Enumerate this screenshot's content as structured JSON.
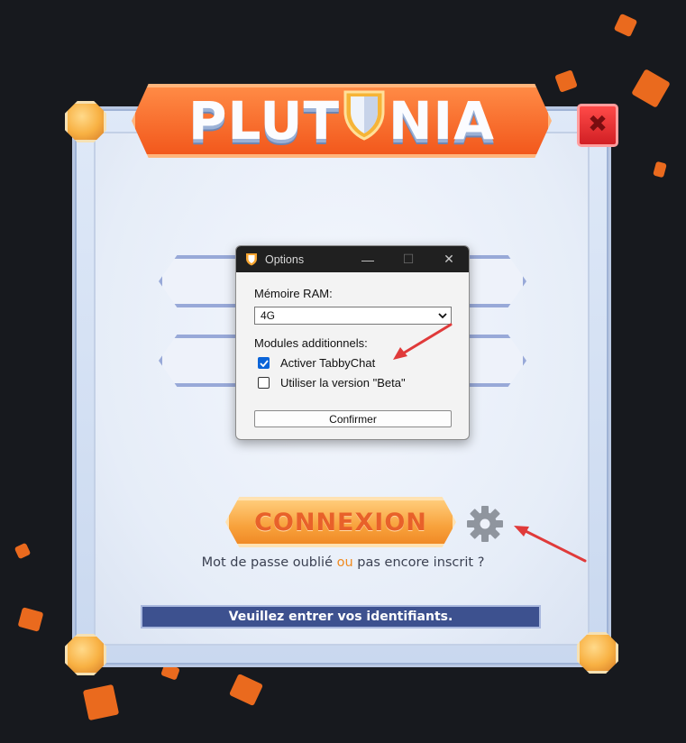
{
  "app": {
    "logo_text_left": "PLUT",
    "logo_text_right": "NIA",
    "close_symbol": "✖",
    "connexion_label": "CONNEXION",
    "forgot": {
      "part1": "Mot de passe oublié",
      "or": "ou",
      "part2": "pas encore inscrit ?"
    },
    "status_text": "Veuillez entrer vos identifiants."
  },
  "dialog": {
    "title": "Options",
    "controls": {
      "minimize": "—",
      "maximize": "☐",
      "close": "✕"
    },
    "ram_label": "Mémoire RAM:",
    "ram_value": "4G",
    "modules_label": "Modules additionnels:",
    "options": [
      {
        "label": "Activer TabbyChat",
        "checked": true
      },
      {
        "label": "Utiliser la version \"Beta\"",
        "checked": false
      }
    ],
    "confirm_label": "Confirmer"
  },
  "colors": {
    "background": "#17191e",
    "accent_orange": "#f2581c",
    "status_bar": "#3d518f",
    "annotation_arrow": "#e03a3a"
  },
  "icons": [
    "shield-icon",
    "close-icon",
    "gear-icon",
    "app-shield-icon",
    "chevron-down-icon",
    "check-icon"
  ]
}
